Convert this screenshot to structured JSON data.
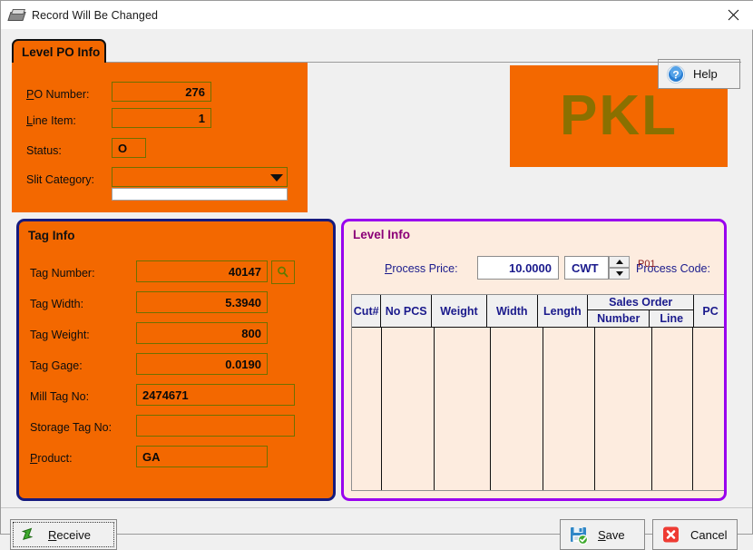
{
  "window": {
    "title": "Record Will Be Changed",
    "icon": "record-change-icon",
    "close_label": "✕"
  },
  "help": {
    "label": "Help",
    "icon": "question-mark-icon"
  },
  "logo": {
    "text": "PKL"
  },
  "tabs": [
    {
      "label": "Level PO Info",
      "active": true
    }
  ],
  "po_info": {
    "fields": [
      {
        "label": "PO Number:",
        "accel": "P",
        "value": "276",
        "align": "right"
      },
      {
        "label": "Line Item:",
        "accel": "L",
        "value": "1",
        "align": "right"
      },
      {
        "label": "Status:",
        "accel": "",
        "value": "O",
        "align": "left"
      },
      {
        "label": "Slit Category:",
        "accel": "",
        "value": "",
        "align": "left"
      }
    ]
  },
  "tag_info": {
    "title": "Tag Info",
    "search_icon": "magnifier-icon",
    "fields": [
      {
        "label": "Tag Number:",
        "value": "40147",
        "align": "right",
        "has_search": true
      },
      {
        "label": "Tag Width:",
        "value": "5.3940",
        "align": "right",
        "has_search": false
      },
      {
        "label": "Tag Weight:",
        "value": "800",
        "align": "right",
        "has_search": false
      },
      {
        "label": "Tag Gage:",
        "value": "0.0190",
        "align": "right",
        "has_search": false
      },
      {
        "label": "Mill Tag No:",
        "value": "2474671",
        "align": "left",
        "has_search": false
      },
      {
        "label": "Storage Tag No:",
        "value": "",
        "align": "left",
        "has_search": false
      },
      {
        "label": "Product:",
        "accel": "P",
        "value": "GA",
        "align": "left",
        "has_search": false
      }
    ]
  },
  "level_info": {
    "title": "Level Info",
    "process_price_label": "Process Price:",
    "process_price_accel": "P",
    "process_price_value": "10.0000",
    "uom_value": "CWT",
    "process_code_label": "Process Code:",
    "process_code_overlap": "P01",
    "grid": {
      "columns": [
        {
          "key": "cut",
          "label": "Cut#",
          "width": 36
        },
        {
          "key": "nopcs",
          "label": "No PCS",
          "width": 62
        },
        {
          "key": "weight",
          "label": "Weight",
          "width": 68
        },
        {
          "key": "width",
          "label": "Width",
          "width": 62
        },
        {
          "key": "length",
          "label": "Length",
          "width": 62
        },
        {
          "key": "sales_order",
          "label": "Sales Order",
          "width": 117,
          "sub": [
            "Number",
            "Line"
          ]
        },
        {
          "key": "pc",
          "label": "PC",
          "width": 40
        }
      ],
      "rows": []
    }
  },
  "buttons": {
    "receive": {
      "label": "Receive",
      "accel": "R",
      "icon": "green-arrow-icon",
      "focused": true
    },
    "save": {
      "label": "Save",
      "accel": "S",
      "icon": "floppy-disk-check-icon"
    },
    "cancel": {
      "label": "Cancel",
      "accel": "",
      "icon": "red-x-icon"
    }
  },
  "colors": {
    "orange": "#f36800",
    "panel_peach": "#fdecdf",
    "tag_border": "#161b7e",
    "level_border": "#9900ee",
    "level_title": "#8b0077",
    "grid_text": "#1a1a8c",
    "logo_text": "#8a7000",
    "field_border": "#6f7000"
  }
}
